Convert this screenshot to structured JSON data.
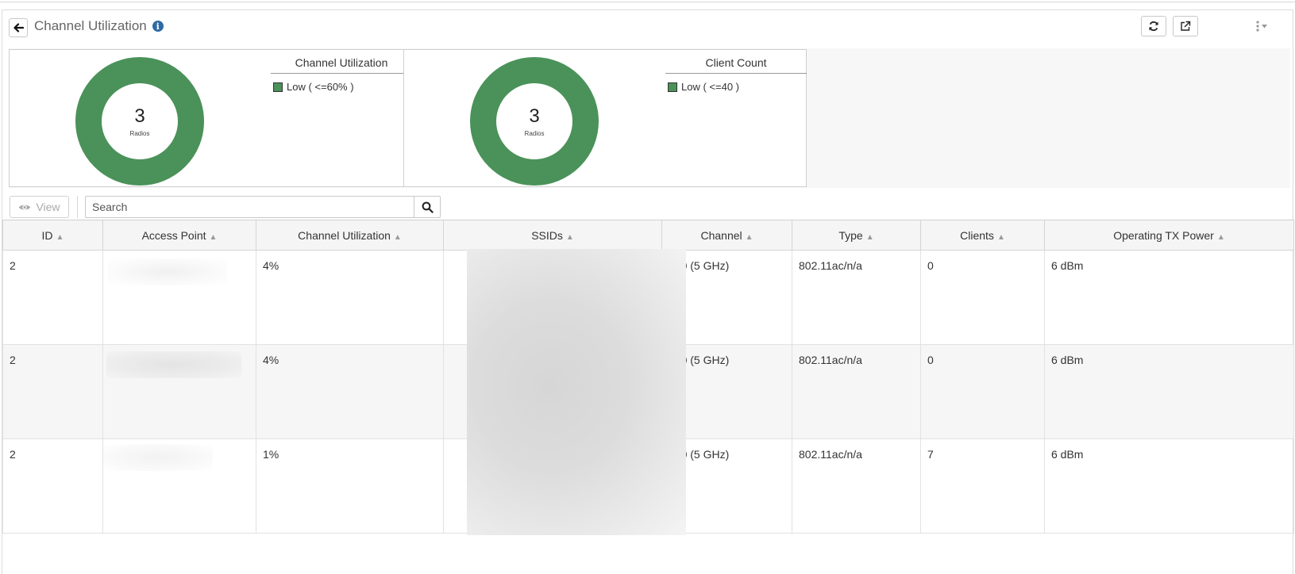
{
  "header": {
    "title": "Channel Utilization"
  },
  "charts": [
    {
      "center_value": "3",
      "center_label": "Radios",
      "legend_title": "Channel Utilization",
      "legend_item": "Low ( <=60% )",
      "color": "#4a9259"
    },
    {
      "center_value": "3",
      "center_label": "Radios",
      "legend_title": "Client Count",
      "legend_item": "Low ( <=40 )",
      "color": "#4a9259"
    }
  ],
  "chart_data": [
    {
      "type": "pie",
      "title": "Channel Utilization",
      "categories": [
        "Low ( <=60% )"
      ],
      "values": [
        3
      ],
      "center_text": "3 Radios"
    },
    {
      "type": "pie",
      "title": "Client Count",
      "categories": [
        "Low ( <=40 )"
      ],
      "values": [
        3
      ],
      "center_text": "3 Radios"
    }
  ],
  "toolbar": {
    "view_label": "View",
    "search_placeholder": "Search"
  },
  "table": {
    "columns": [
      "ID",
      "Access Point",
      "Channel Utilization",
      "SSIDs",
      "Channel",
      "Type",
      "Clients",
      "Operating TX Power"
    ],
    "rows": [
      {
        "id": "2",
        "access_point": "",
        "channel_utilization": "4%",
        "ssids": "",
        "channel": "140 (5 GHz)",
        "type": "802.11ac/n/a",
        "clients": "0",
        "tx_power": "6 dBm"
      },
      {
        "id": "2",
        "access_point": "",
        "channel_utilization": "4%",
        "ssids": "",
        "channel": "140 (5 GHz)",
        "type": "802.11ac/n/a",
        "clients": "0",
        "tx_power": "6 dBm"
      },
      {
        "id": "2",
        "access_point": "",
        "channel_utilization": "1%",
        "ssids": "",
        "channel": "100 (5 GHz)",
        "type": "802.11ac/n/a",
        "clients": "7",
        "tx_power": "6 dBm"
      }
    ]
  },
  "icons": [
    "back-arrow-icon",
    "info-icon",
    "refresh-icon",
    "external-link-icon",
    "more-options-icon",
    "eye-icon",
    "search-icon",
    "sort-icon"
  ]
}
